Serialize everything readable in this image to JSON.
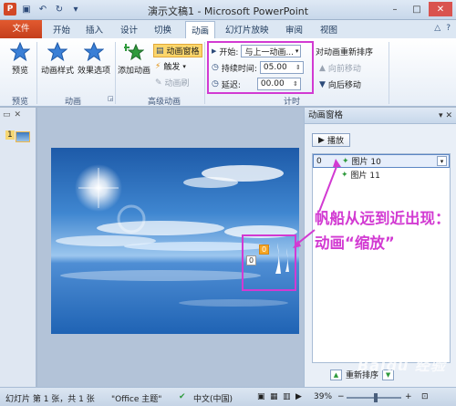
{
  "window": {
    "title": "演示文稿1 - Microsoft PowerPoint",
    "quick_access": [
      "ppt-logo",
      "save-icon",
      "undo-icon",
      "redo-icon",
      "customize-icon"
    ],
    "controls": [
      "minimize-icon",
      "maximize-icon",
      "close-icon"
    ]
  },
  "tabs": [
    {
      "label": "文件"
    },
    {
      "label": "开始"
    },
    {
      "label": "插入"
    },
    {
      "label": "设计"
    },
    {
      "label": "切换"
    },
    {
      "label": "动画"
    },
    {
      "label": "幻灯片放映"
    },
    {
      "label": "审阅"
    },
    {
      "label": "视图"
    }
  ],
  "ribbon": {
    "preview": {
      "button": "预览",
      "group": "预览"
    },
    "animation": {
      "styles": "动画样式",
      "effects": "效果选项",
      "group": "动画"
    },
    "advanced": {
      "add": "添加动画",
      "pane": "动画窗格",
      "trigger": "触发",
      "painter": "动画刷",
      "group": "高级动画"
    },
    "timing": {
      "start_label": "开始:",
      "start_value": "与上一动画...",
      "duration_label": "持续时间:",
      "duration_value": "05.00",
      "delay_label": "延迟:",
      "delay_value": "00.00",
      "reorder_title": "对动画重新排序",
      "move_earlier": "向前移动",
      "move_later": "向后移动",
      "group": "计时"
    }
  },
  "slide_panel": {
    "slide_number": "1"
  },
  "slide": {
    "tag_top": "0",
    "tag_left": "0"
  },
  "animation_pane": {
    "title": "动画窗格",
    "play": "播放",
    "items": [
      {
        "number": "0",
        "name": "图片 10",
        "selected": true
      },
      {
        "number": "",
        "name": "图片 11",
        "selected": false
      }
    ],
    "reorder": "重新排序"
  },
  "annotation": "帆船从远到近出现：动画“缩放”",
  "watermark": "Baidu 经验",
  "statusbar": {
    "slide": "幻灯片 第 1 张，共 1 张",
    "theme": "\"Office 主题\"",
    "language": "中文(中国)",
    "zoom": "39%",
    "zoom_fraction": 0.39
  },
  "colors": {
    "accent": "#d23ad2",
    "file_tab": "#d24726",
    "ribbon_bg": "#e7eef7"
  }
}
